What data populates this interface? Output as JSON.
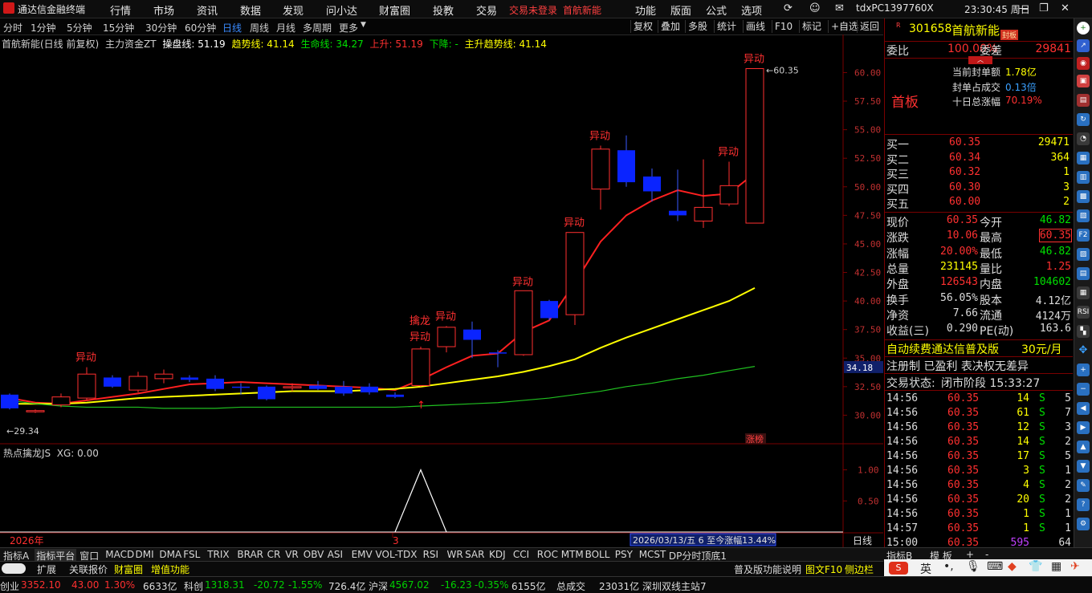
{
  "titlebar": {
    "app_name": "通达信金融终端",
    "menus": [
      "行情",
      "市场",
      "资讯",
      "数据",
      "发现",
      "问小达",
      "财富圈",
      "投教",
      "交易"
    ],
    "trade_status": "交易未登录",
    "stock_link": "首航新能",
    "right_menus": [
      "功能",
      "版面",
      "公式",
      "选项"
    ],
    "machine": "tdxPC1397760X",
    "clock": "23:30:45 周日"
  },
  "periodbar": {
    "periods": [
      "分时",
      "1分钟",
      "5分钟",
      "15分钟",
      "30分钟",
      "60分钟",
      "日线",
      "周线",
      "月线",
      "多周期",
      "更多"
    ],
    "active": "日线",
    "buttons": [
      "复权",
      "叠加",
      "多股",
      "统计",
      "画线",
      "F10",
      "标记",
      "+自选",
      "返回"
    ]
  },
  "indicator_header": {
    "stock": "首航新能(日线 前复权)",
    "indicator": "主力资金ZT",
    "items": [
      {
        "label": "操盘线: 51.19",
        "color": "#ffffff"
      },
      {
        "label": "趋势线: 41.14",
        "color": "#ffff00"
      },
      {
        "label": "生命线: 34.27",
        "color": "#00e000"
      },
      {
        "label": "上升: 51.19",
        "color": "#ff3030"
      },
      {
        "label": "下降: -",
        "color": "#00e000"
      },
      {
        "label": "主升趋势线: 41.14",
        "color": "#ffff00"
      }
    ]
  },
  "sub_header": "热点擒龙JS  XG: 0.00",
  "chart_data": {
    "type": "candlestick",
    "ylim": [
      27.5,
      62
    ],
    "y_ticks": [
      30.0,
      32.5,
      35.0,
      37.5,
      40.0,
      42.5,
      45.0,
      47.5,
      50.0,
      52.5,
      55.0,
      57.5,
      60.0
    ],
    "current_price_label": "34.18",
    "max_label": "60.35",
    "min_label": "29.34",
    "candles": [
      {
        "o": 31.8,
        "h": 31.9,
        "l": 30.5,
        "c": 30.6
      },
      {
        "o": 30.3,
        "h": 30.5,
        "l": 30.2,
        "c": 30.4
      },
      {
        "o": 30.9,
        "h": 31.9,
        "l": 30.7,
        "c": 31.6
      },
      {
        "o": 31.5,
        "h": 34.2,
        "l": 31.3,
        "c": 33.6,
        "tag": "异动"
      },
      {
        "o": 33.3,
        "h": 33.5,
        "l": 32.4,
        "c": 32.5
      },
      {
        "o": 32.2,
        "h": 33.8,
        "l": 32.0,
        "c": 33.4
      },
      {
        "o": 33.2,
        "h": 34.0,
        "l": 32.8,
        "c": 33.6
      },
      {
        "o": 33.3,
        "h": 33.5,
        "l": 32.9,
        "c": 33.1
      },
      {
        "o": 33.2,
        "h": 33.5,
        "l": 32.1,
        "c": 32.3
      },
      {
        "o": 32.5,
        "h": 32.8,
        "l": 31.8,
        "c": 32.4
      },
      {
        "o": 32.5,
        "h": 32.6,
        "l": 31.3,
        "c": 31.4
      },
      {
        "o": 32.4,
        "h": 32.8,
        "l": 32.1,
        "c": 32.5
      },
      {
        "o": 32.6,
        "h": 33.0,
        "l": 32.2,
        "c": 32.3
      },
      {
        "o": 32.5,
        "h": 33.0,
        "l": 31.7,
        "c": 31.9
      },
      {
        "o": 32.5,
        "h": 32.8,
        "l": 31.8,
        "c": 32.0
      },
      {
        "o": 31.8,
        "h": 32.0,
        "l": 31.5,
        "c": 31.6
      },
      {
        "o": 32.6,
        "h": 36.0,
        "l": 32.5,
        "c": 35.8,
        "tag": "异动",
        "tag2": "擒龙"
      },
      {
        "o": 36.0,
        "h": 37.8,
        "l": 35.5,
        "c": 37.7,
        "tag": "异动"
      },
      {
        "o": 37.5,
        "h": 38.2,
        "l": 35.0,
        "c": 36.6
      },
      {
        "o": 35.5,
        "h": 35.7,
        "l": 34.2,
        "c": 35.4
      },
      {
        "o": 35.3,
        "h": 40.8,
        "l": 35.2,
        "c": 40.9,
        "tag": "异动"
      },
      {
        "o": 40.0,
        "h": 40.1,
        "l": 38.3,
        "c": 38.5
      },
      {
        "o": 38.8,
        "h": 46.0,
        "l": 37.9,
        "c": 46.0,
        "tag": "异动"
      },
      {
        "o": 49.8,
        "h": 53.6,
        "l": 48.0,
        "c": 53.3,
        "tag": "异动"
      },
      {
        "o": 53.2,
        "h": 54.5,
        "l": 50.0,
        "c": 50.4
      },
      {
        "o": 50.9,
        "h": 51.6,
        "l": 48.7,
        "c": 49.6
      },
      {
        "o": 47.9,
        "h": 51.5,
        "l": 47.0,
        "c": 47.5
      },
      {
        "o": 47.0,
        "h": 52.4,
        "l": 46.4,
        "c": 48.2
      },
      {
        "o": 48.5,
        "h": 52.2,
        "l": 48.3,
        "c": 50.1,
        "tag": "异动"
      },
      {
        "o": 46.82,
        "h": 60.35,
        "l": 46.82,
        "c": 60.35,
        "tag": "异动"
      }
    ],
    "lines": {
      "操盘线": [
        31.5,
        31.1,
        31.0,
        31.3,
        31.6,
        31.9,
        32.3,
        32.7,
        32.8,
        32.9,
        32.8,
        32.7,
        32.6,
        32.5,
        32.4,
        32.2,
        33.1,
        34.2,
        35.2,
        35.4,
        37.3,
        38.3,
        41.6,
        45.2,
        47.5,
        48.8,
        49.7,
        49.2,
        49.4,
        51.19
      ],
      "趋势线": [
        31.0,
        31.0,
        31.0,
        31.1,
        31.3,
        31.5,
        31.6,
        31.7,
        31.8,
        31.9,
        32.0,
        32.1,
        32.1,
        32.1,
        32.2,
        32.3,
        32.5,
        32.8,
        33.1,
        33.4,
        33.8,
        34.3,
        34.9,
        35.9,
        36.8,
        37.6,
        38.4,
        39.2,
        40.0,
        41.14
      ],
      "生命线": [
        31.3,
        31.0,
        30.8,
        30.7,
        30.7,
        30.7,
        30.6,
        30.6,
        30.6,
        30.7,
        30.7,
        30.7,
        30.7,
        30.7,
        30.7,
        30.7,
        30.8,
        30.9,
        31.0,
        31.1,
        31.3,
        31.5,
        31.8,
        32.1,
        32.5,
        32.8,
        33.2,
        33.5,
        33.9,
        34.27
      ]
    },
    "sub_indicator": {
      "name": "热点擒龙JS",
      "series": "XG",
      "ylim": [
        0,
        1.2
      ],
      "ticks": [
        0.5,
        1.0
      ]
    },
    "x_labels": [
      "2026年",
      "3"
    ],
    "date_box": "2026/03/13/五 6 至今涨幅13.44%",
    "zhang_tag": "涨榜"
  },
  "quote": {
    "code": "301658",
    "name": "首航新能",
    "badge": "封板",
    "weibi_label": "委比",
    "weibi": "100.00%",
    "weicha_label": "委差",
    "weicha": "29841",
    "shouban": "首板",
    "stats": [
      {
        "label": "当前封单额",
        "value": "1.78亿"
      },
      {
        "label": "封单占成交",
        "value": "0.13倍"
      },
      {
        "label": "十日总涨幅",
        "value": "70.19%"
      }
    ],
    "bids": [
      {
        "label": "买一",
        "price": "60.35",
        "vol": "29471"
      },
      {
        "label": "买二",
        "price": "60.34",
        "vol": "364"
      },
      {
        "label": "买三",
        "price": "60.32",
        "vol": "1"
      },
      {
        "label": "买四",
        "price": "60.30",
        "vol": "3"
      },
      {
        "label": "买五",
        "price": "60.00",
        "vol": "2"
      }
    ],
    "fields": [
      {
        "l1": "现价",
        "v1": "60.35",
        "l2": "今开",
        "v2": "46.82"
      },
      {
        "l1": "涨跌",
        "v1": "10.06",
        "l2": "最高",
        "v2": "60.35"
      },
      {
        "l1": "涨幅",
        "v1": "20.00%",
        "l2": "最低",
        "v2": "46.82"
      },
      {
        "l1": "总量",
        "v1": "231145",
        "l2": "量比",
        "v2": "1.25"
      },
      {
        "l1": "外盘",
        "v1": "126543",
        "l2": "内盘",
        "v2": "104602"
      },
      {
        "l1": "换手",
        "v1": "56.05%",
        "l2": "股本",
        "v2": "4.12亿"
      },
      {
        "l1": "净资",
        "v1": "7.66",
        "l2": "流通",
        "v2": "4124万"
      },
      {
        "l1": "收益(三)",
        "v1": "0.290",
        "l2": "PE(动)",
        "v2": "163.6"
      }
    ],
    "ad_line": "自动续费通达信普及版",
    "ad_price": "30元/月",
    "reg_line": "注册制 已盈利 表决权无差异",
    "trade_state_label": "交易状态:",
    "trade_state": "闭市阶段 15:33:27",
    "ticks": [
      {
        "t": "14:56",
        "p": "60.35",
        "v": "14",
        "d": "S",
        "n": "5"
      },
      {
        "t": "14:56",
        "p": "60.35",
        "v": "61",
        "d": "S",
        "n": "7"
      },
      {
        "t": "14:56",
        "p": "60.35",
        "v": "12",
        "d": "S",
        "n": "3"
      },
      {
        "t": "14:56",
        "p": "60.35",
        "v": "14",
        "d": "S",
        "n": "2"
      },
      {
        "t": "14:56",
        "p": "60.35",
        "v": "17",
        "d": "S",
        "n": "5"
      },
      {
        "t": "14:56",
        "p": "60.35",
        "v": "3",
        "d": "S",
        "n": "1"
      },
      {
        "t": "14:56",
        "p": "60.35",
        "v": "4",
        "d": "S",
        "n": "2"
      },
      {
        "t": "14:56",
        "p": "60.35",
        "v": "20",
        "d": "S",
        "n": "2"
      },
      {
        "t": "14:56",
        "p": "60.35",
        "v": "1",
        "d": "S",
        "n": "1"
      },
      {
        "t": "14:57",
        "p": "60.35",
        "v": "1",
        "d": "S",
        "n": "1"
      },
      {
        "t": "15:00",
        "p": "60.35",
        "v": "595",
        "d": "",
        "n": "64"
      }
    ]
  },
  "bottom_tabs": [
    "指标A",
    "指标平台",
    "窗口",
    "MACD",
    "DMI",
    "DMA",
    "FSL",
    "TRIX",
    "BRAR",
    "CR",
    "VR",
    "OBV",
    "ASI",
    "EMV",
    "VOL-TDX",
    "RSI",
    "WR",
    "SAR",
    "KDJ",
    "CCI",
    "ROC",
    "MTM",
    "BOLL",
    "PSY",
    "MCST",
    "DP分时顶底1"
  ],
  "bottom_right_tabs": [
    "指标B",
    "模 板",
    "+",
    "-"
  ],
  "ext_tabs": [
    "扩展",
    "关联报价",
    "财富圈",
    "增值功能"
  ],
  "ext_right": [
    "普及版功能说明",
    "图文F10",
    "侧边栏"
  ],
  "status": {
    "items": [
      {
        "label": "创业",
        "value": "3352.10",
        "chg": "43.00",
        "pct": "1.30%",
        "amt": "6633亿"
      },
      {
        "label": "科创",
        "value": "1318.31",
        "chg": "-20.72",
        "pct": "-1.55%",
        "amt": "726.4亿"
      },
      {
        "label": "沪深",
        "value": "4567.02",
        "chg": "-16.23",
        "pct": "-0.35%",
        "amt": "6155亿"
      }
    ],
    "total_label": "总成交",
    "total": "23031亿",
    "server": "深圳双线主站7"
  },
  "ime": {
    "lang": "英"
  },
  "colors": {
    "up": "#ff3030",
    "down": "#0a24ff",
    "bg": "#000000",
    "text_yellow": "#ffff00"
  }
}
